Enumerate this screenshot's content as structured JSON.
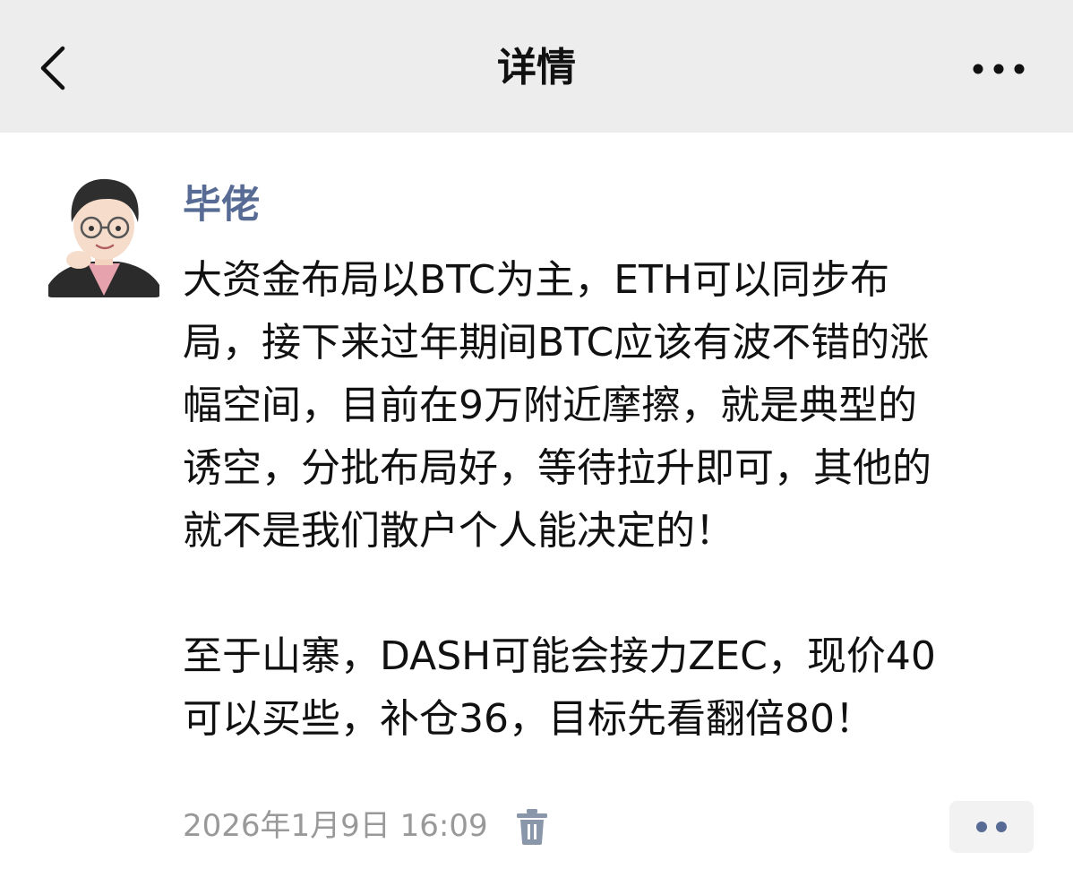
{
  "header": {
    "title": "详情",
    "back_icon": "chevron-left-icon",
    "more_icon": "more-horizontal-icon"
  },
  "post": {
    "author": "毕佬",
    "avatar_icon": "cartoon-avatar",
    "paragraphs": [
      "大资金布局以BTC为主，ETH可以同步布\n局，接下来过年期间BTC应该有波不错的涨\n幅空间，目前在9万附近摩擦，就是典型的\n诱空，分批布局好，等待拉升即可，其他的\n就不是我们散户个人能决定的！",
      "至于山寨，DASH可能会接力ZEC，现价40\n可以买些，补仓36，目标先看翻倍80！"
    ],
    "timestamp": "2026年1月9日 16:09",
    "delete_icon": "trash-icon",
    "action_icon": "two-dots-icon"
  },
  "colors": {
    "nav_background": "#ededed",
    "author_name": "#576b95",
    "timestamp": "#999999",
    "icon_gray": "#8a96aa"
  }
}
